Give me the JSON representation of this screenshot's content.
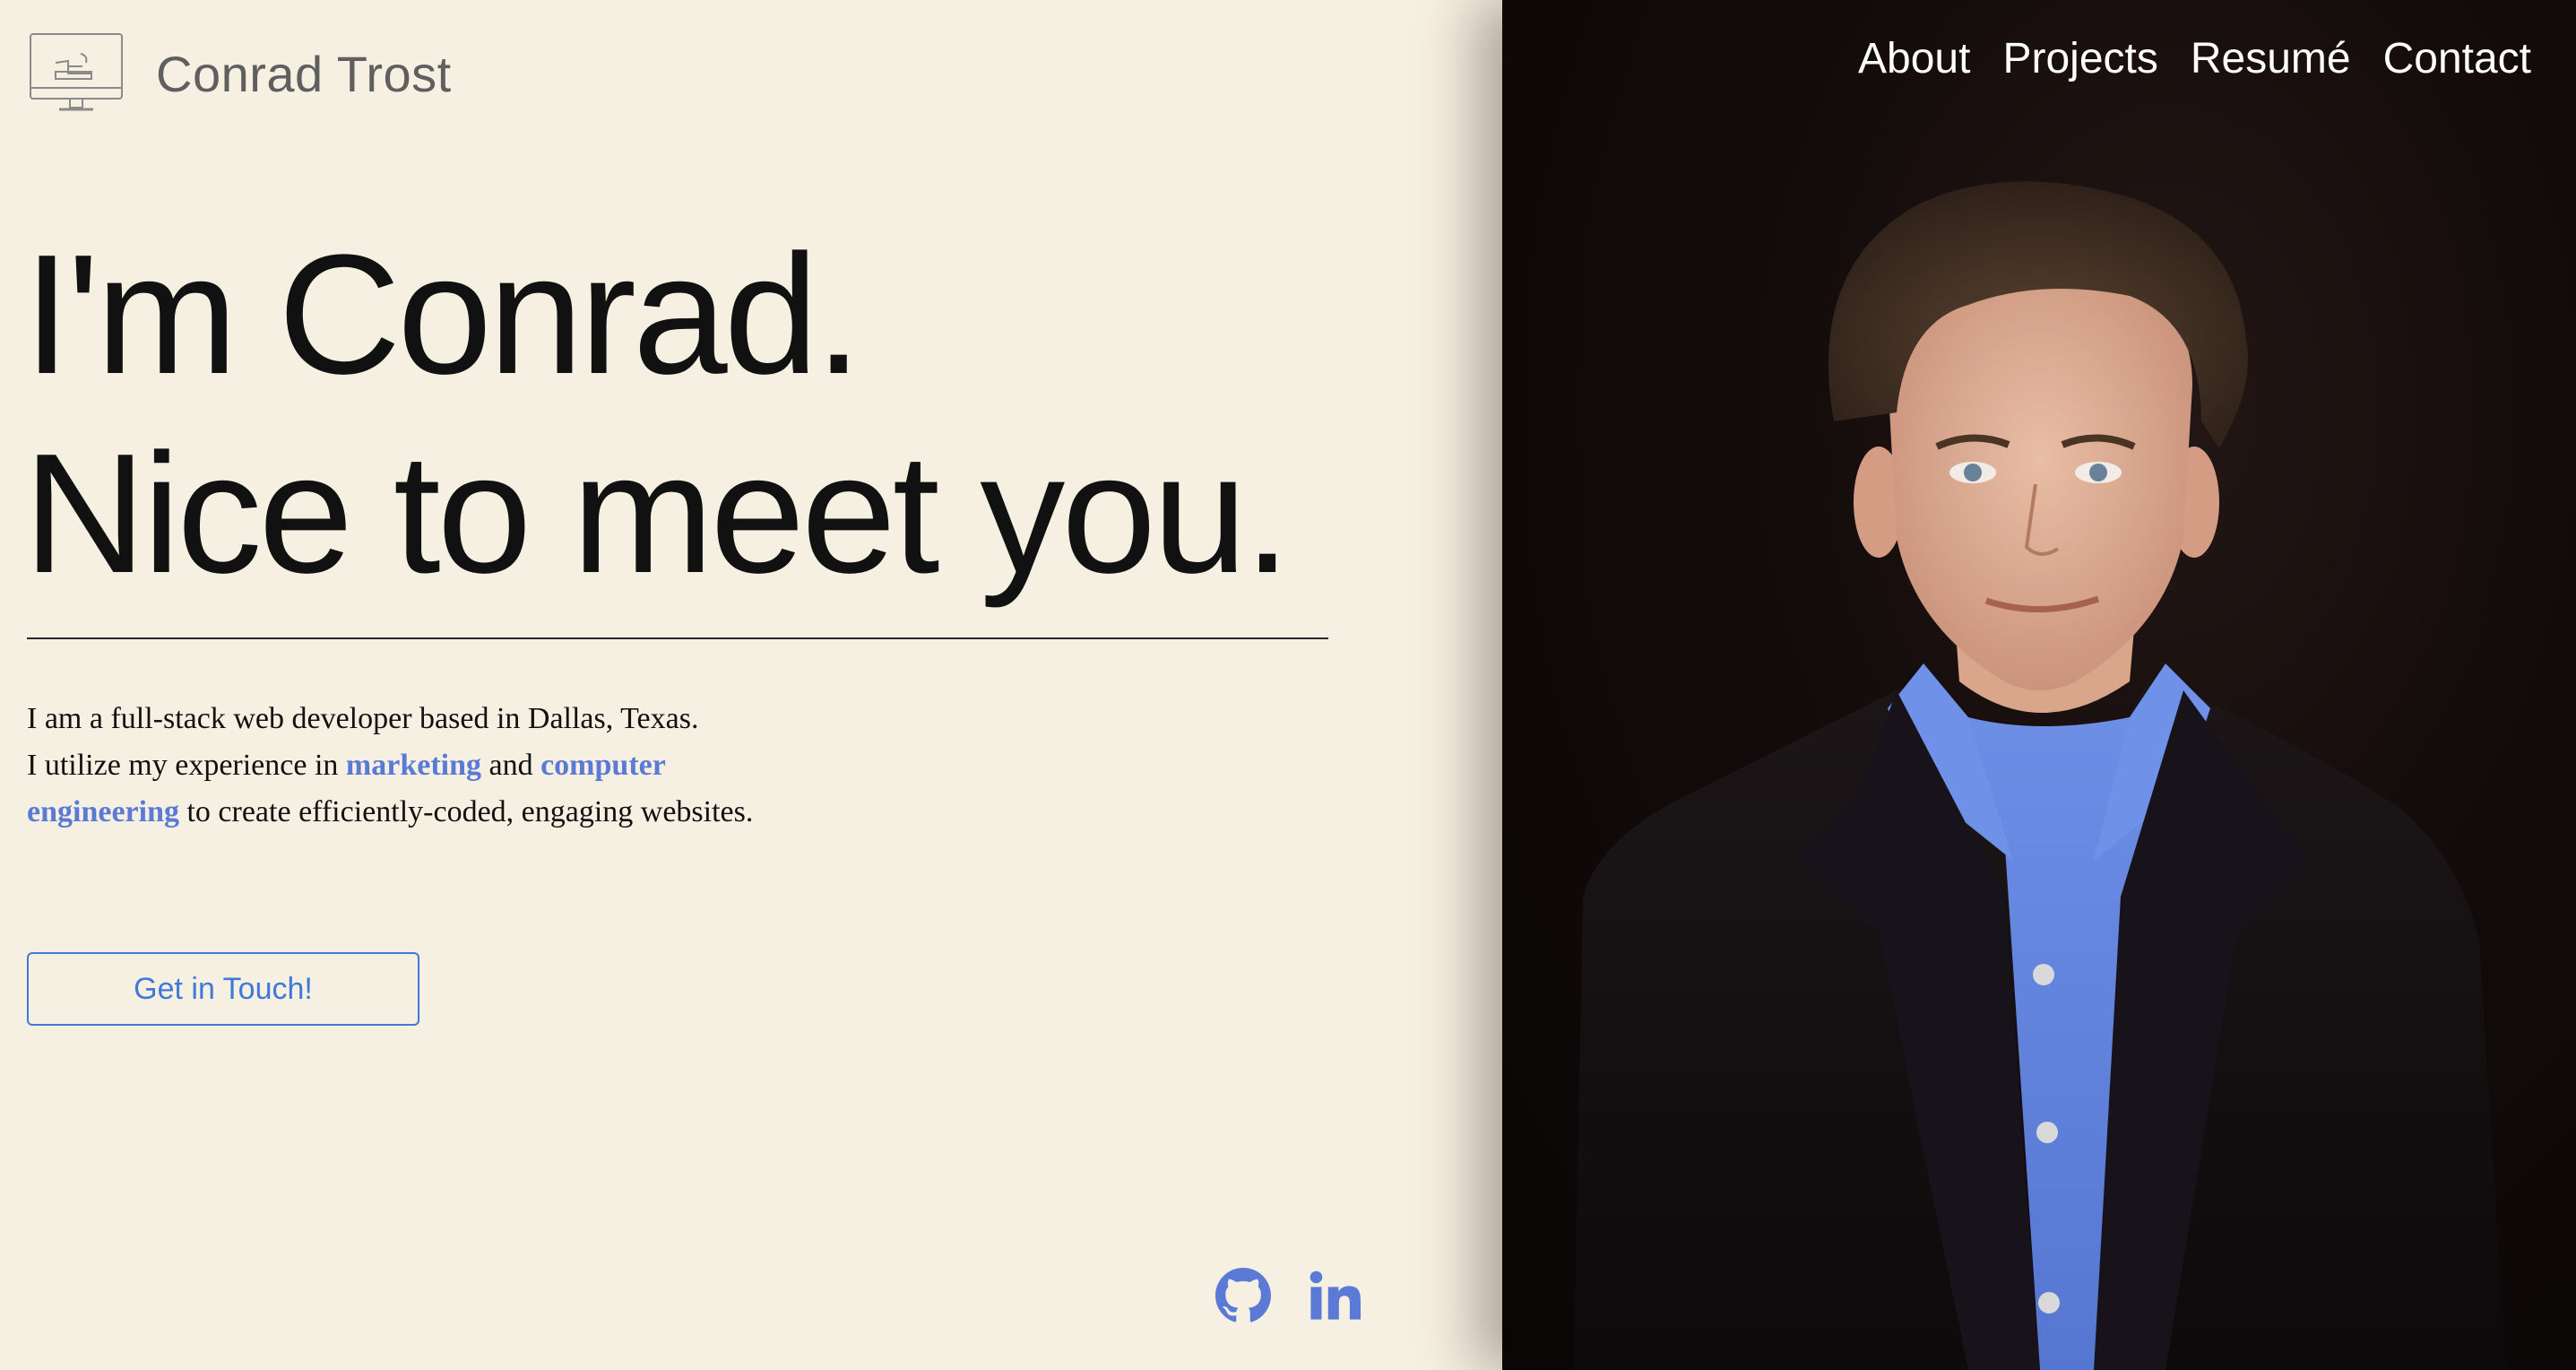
{
  "brand": {
    "name": "Conrad Trost"
  },
  "nav": {
    "items": [
      {
        "label": "About"
      },
      {
        "label": "Projects"
      },
      {
        "label": "Resumé"
      },
      {
        "label": "Contact"
      }
    ]
  },
  "hero": {
    "line1": "I'm Conrad.",
    "line2": "Nice to meet you."
  },
  "bio": {
    "sentence1": "I am a full-stack web developer based in Dallas, Texas.",
    "part1": "I utilize my experience in ",
    "highlight1": "marketing",
    "part2": " and ",
    "highlight2": "computer engineering",
    "part3": " to create efficiently-coded, engaging websites."
  },
  "cta": {
    "label": "Get in Touch!"
  },
  "social": {
    "github_icon": "github-icon",
    "linkedin_icon": "linkedin-icon"
  },
  "colors": {
    "background": "#f6f0e2",
    "accent": "#5b7ad6",
    "button": "#3f7ad8",
    "photo_bg": "#120b0a"
  }
}
